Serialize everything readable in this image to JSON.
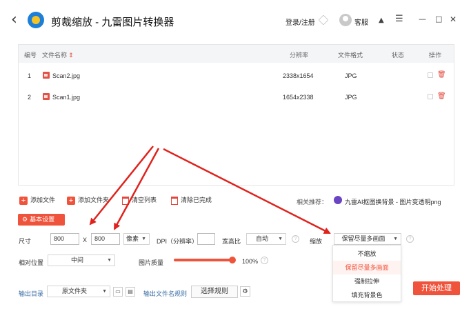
{
  "window": {
    "back_glyph": "‹",
    "title": "剪裁缩放 - 九雷图片转换器",
    "login_label": "登录/注册",
    "service_label": "客服",
    "controls": [
      "▲",
      "☰",
      "—",
      "□",
      "✕"
    ]
  },
  "table": {
    "headers": {
      "index": "编号",
      "filename": "文件名称",
      "resolution": "分辨率",
      "format": "文件格式",
      "status": "状态",
      "actions": "操作"
    },
    "rows": [
      {
        "index": "1",
        "filename": "Scan2.jpg",
        "resolution": "2338x1654",
        "format": "JPG",
        "status": ""
      },
      {
        "index": "2",
        "filename": "Scan1.jpg",
        "resolution": "1654x2338",
        "format": "JPG",
        "status": ""
      }
    ]
  },
  "actions": {
    "add_file": "添加文件",
    "add_folder": "添加文件夹",
    "clear_list": "清空列表",
    "clear_done": "清除已完成",
    "recommend_label": "相关推荐：",
    "recommend_link": "九雷AI抠图换背景 - 图片变透明png"
  },
  "settings": {
    "basic_label": "基本设置",
    "size_label": "尺寸",
    "width": "800",
    "times": "X",
    "height": "800",
    "unit": "像素",
    "dpi_label": "DPI（分辨率）",
    "dpi_value": "",
    "aspect_label": "宽高比",
    "aspect_value": "自动",
    "scale_label": "缩放",
    "scale_value": "保留尽量多画面",
    "position_label": "相对位置",
    "position_value": "中间",
    "quality_label": "图片质量",
    "quality_value": "100%",
    "quality_fraction": 1.0,
    "scale_options": [
      "不缩放",
      "保留尽量多画面",
      "强制拉伸",
      "填充背景色"
    ],
    "selected_option_index": 1,
    "output_dir_label": "输出目录",
    "output_dir_value": "原文件夹",
    "naming_rule_label": "输出文件名规则",
    "naming_rule_button": "选择规则",
    "start_button": "开始处理"
  },
  "colors": {
    "accent": "#f0533b",
    "annotation_arrow": "#e0221c",
    "link_blue": "#3a6ea5"
  }
}
